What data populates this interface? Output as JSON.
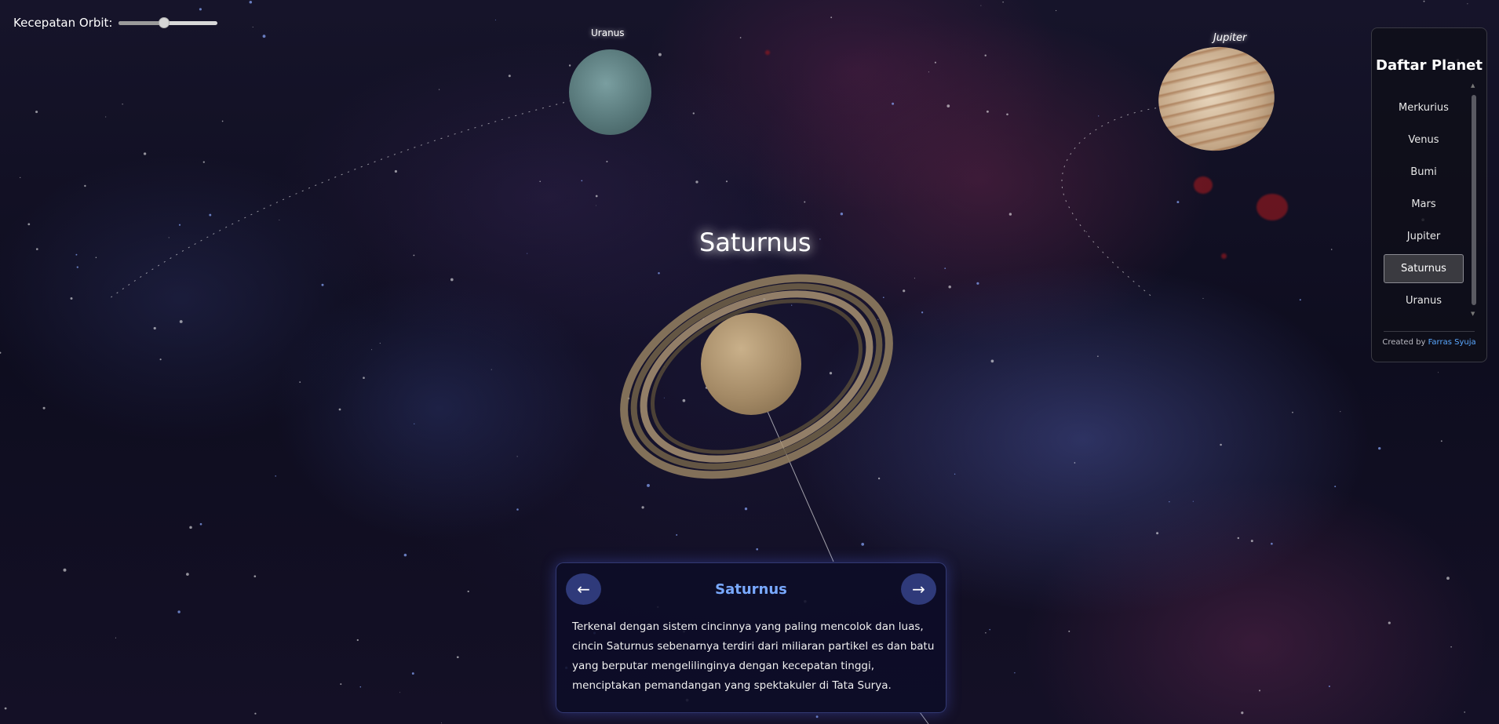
{
  "speed_control": {
    "label": "Kecepatan Orbit:",
    "value_fraction": 0.46
  },
  "planet_labels": {
    "uranus": "Uranus",
    "jupiter": "Jupiter",
    "selected": "Saturnus"
  },
  "planet_panel": {
    "title": "Daftar Planet",
    "items": [
      {
        "label": "Merkurius",
        "active": false
      },
      {
        "label": "Venus",
        "active": false
      },
      {
        "label": "Bumi",
        "active": false
      },
      {
        "label": "Mars",
        "active": false
      },
      {
        "label": "Jupiter",
        "active": false
      },
      {
        "label": "Saturnus",
        "active": true
      },
      {
        "label": "Uranus",
        "active": false
      }
    ],
    "credit_prefix": "Created by",
    "credit_name": "Farras Syuja"
  },
  "info_card": {
    "prev_label": "←",
    "next_label": "→",
    "title": "Saturnus",
    "lines": [
      "Terkenal dengan sistem cincinnya yang paling mencolok dan luas,",
      "cincin Saturnus sebenarnya terdiri dari miliaran partikel es dan batu",
      "yang berputar mengelilinginya dengan kecepatan tinggi,",
      "menciptakan pemandangan yang spektakuler di Tata Surya."
    ]
  },
  "colors": {
    "accent_title": "#79a9ff",
    "credit_link": "#5aa8ff",
    "nav_button": "#2f3a7a",
    "background": "#0b0b1a"
  }
}
